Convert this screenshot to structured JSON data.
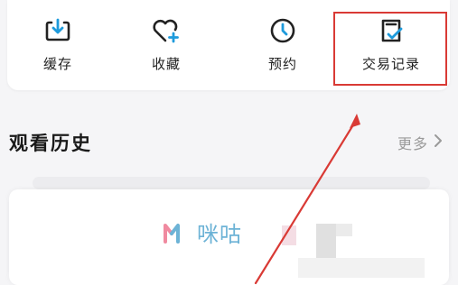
{
  "quick_actions": [
    {
      "label": "缓存",
      "icon": "download-icon"
    },
    {
      "label": "收藏",
      "icon": "heart-plus-icon"
    },
    {
      "label": "预约",
      "icon": "clock-icon"
    },
    {
      "label": "交易记录",
      "icon": "transaction-record-icon"
    }
  ],
  "history": {
    "title": "观看历史",
    "more_label": "更多",
    "more_icon": "chevron-right-icon",
    "thumbnail_logo_text": "咪咕"
  },
  "colors": {
    "accent_blue": "#1e9bdc",
    "annotation_red": "#d93a35",
    "logo_blue": "#6db3d6",
    "logo_pink": "#f08aa0"
  }
}
